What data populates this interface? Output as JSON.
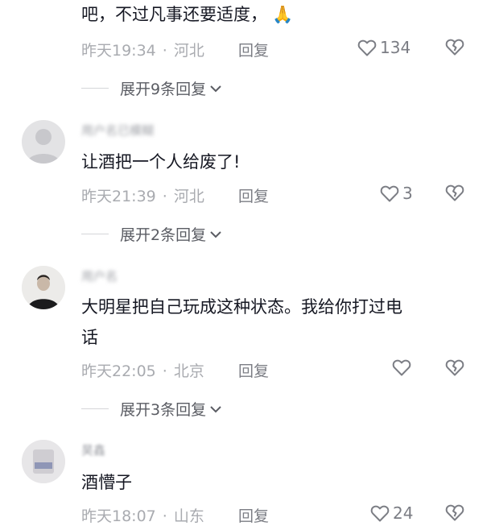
{
  "comments": [
    {
      "text_lines": [
        "吧，不过凡事还要适度，"
      ],
      "emoji": "🙏",
      "time": "昨天19:34",
      "location": "河北",
      "reply_label": "回复",
      "likes": "134",
      "expand_label": "展开9条回复"
    },
    {
      "username": "用户名已模糊",
      "text_lines": [
        "让酒把一个人给废了!"
      ],
      "time": "昨天21:39",
      "location": "河北",
      "reply_label": "回复",
      "likes": "3",
      "expand_label": "展开2条回复"
    },
    {
      "username": "用户名",
      "text_lines": [
        "大明星把自己玩成这种状态。我给你打过电",
        "话"
      ],
      "time": "昨天22:05",
      "location": "北京",
      "reply_label": "回复",
      "likes": "",
      "expand_label": "展开3条回复"
    },
    {
      "username": "昊鑫",
      "text_lines": [
        "酒懵子"
      ],
      "time": "昨天18:07",
      "location": "山东",
      "reply_label": "回复",
      "likes": "24"
    }
  ],
  "meta_separator": "·",
  "colors": {
    "text": "#161823",
    "meta": "#a9abb0",
    "icon": "#7b7d84"
  }
}
